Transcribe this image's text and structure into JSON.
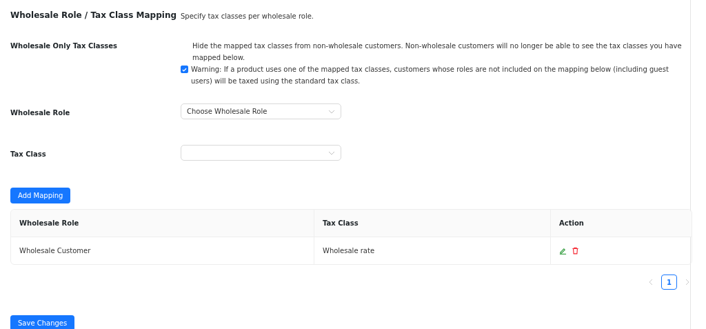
{
  "section": {
    "title": "Wholesale Role / Tax Class Mapping",
    "description": "Specify tax classes per wholesale role."
  },
  "wholesale_only": {
    "label": "Wholesale Only Tax Classes",
    "checked": true,
    "description": "Hide the mapped tax classes from non-wholesale customers. Non-wholesale customers will no longer be able to see the tax classes you have mapped below.",
    "warning": "Warning: If a product uses one of the mapped tax classes, customers whose roles are not included on the mapping below (including guest users) will be taxed using the standard tax class."
  },
  "fields": [
    {
      "label": "Wholesale Role",
      "placeholder": "Choose Wholesale Role"
    },
    {
      "label": "Tax Class"
    }
  ],
  "add_button": "Add Mapping",
  "table": {
    "columns": [
      "Wholesale Role",
      "Tax Class",
      "Action"
    ],
    "rows": [
      {
        "role": "Wholesale Customer",
        "tax_class": "Wholesale rate"
      }
    ]
  },
  "pagination": {
    "prev_disabled": true,
    "next_disabled": true,
    "pages": [
      {
        "label": "1",
        "selected": true
      }
    ]
  },
  "save_button": "Save Changes"
}
